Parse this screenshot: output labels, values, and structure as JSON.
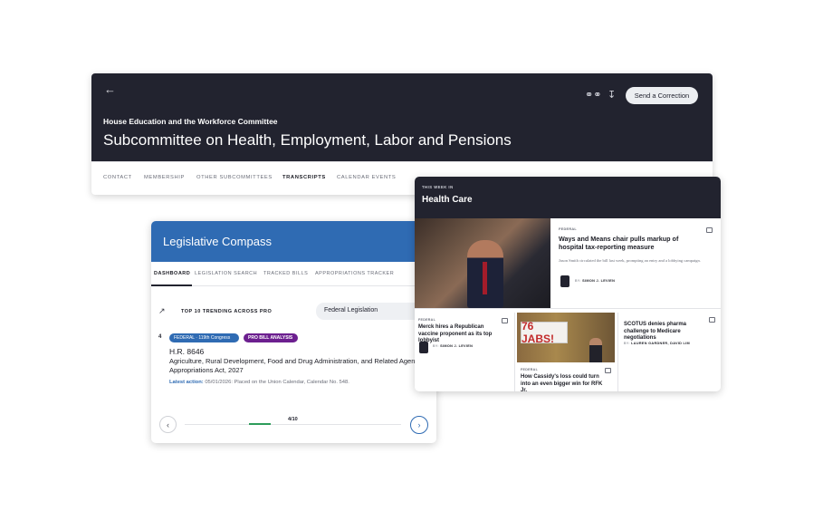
{
  "committee": {
    "back_icon": "arrow-left-icon",
    "kicker": "House Education and the Workforce Committee",
    "title": "Subcommittee on Health, Employment, Labor and Pensions",
    "icons": [
      "binoculars-icon",
      "download-icon"
    ],
    "correction_button": "Send a Correction",
    "tabs": [
      {
        "label": "CONTACT",
        "active": false
      },
      {
        "label": "MEMBERSHIP",
        "active": false
      },
      {
        "label": "OTHER SUBCOMMITTEES",
        "active": false
      },
      {
        "label": "TRANSCRIPTS",
        "active": true
      },
      {
        "label": "CALENDAR EVENTS",
        "active": false
      }
    ],
    "colors": {
      "header_bg": "#22232f"
    }
  },
  "compass": {
    "title": "Legislative Compass",
    "tabs": [
      {
        "label": "DASHBOARD",
        "active": true
      },
      {
        "label": "LEGISLATION SEARCH",
        "active": false
      },
      {
        "label": "TRACKED BILLS",
        "active": false
      },
      {
        "label": "APPROPRIATIONS TRACKER",
        "active": false
      }
    ],
    "trending_label": "TOP 10 TRENDING ACROSS PRO",
    "dropdown_value": "Federal Legislation",
    "item": {
      "rank": "4",
      "badge_federal": "FEDERAL · 119th Congress",
      "badge_pro": "PRO BILL ANALYSIS",
      "bill_number": "H.R. 8646",
      "description": "Agriculture, Rural Development, Food and Drug Administration, and Related Agency Appropriations Act, 2027",
      "action_label": "Latest action:",
      "action_text": "05/01/2026: Placed on the Union Calendar, Calendar No. 548."
    },
    "pager": {
      "prev_icon": "chevron-left-icon",
      "next_icon": "chevron-right-icon",
      "page": "4/10",
      "current": 4,
      "total": 10
    },
    "colors": {
      "header_bg": "#2f6bb3",
      "pro_badge": "#6c1f8f",
      "progress": "#2d9c5a"
    }
  },
  "health": {
    "kicker": "THIS WEEK IN",
    "title": "Health Care",
    "main_story": {
      "tag": "FEDERAL",
      "headline": "Ways and Means chair pulls markup of hospital tax-reporting measure",
      "summary": "Jason Smith circulated the bill last week, prompting an entry and a lobbying campaign.",
      "by": "BY:",
      "author": "SIMON J. LEVIEN"
    },
    "stories": [
      {
        "tag": "FEDERAL",
        "headline": "Merck hires a Republican vaccine proponent as its top lobbyist",
        "by": "BY:",
        "author": "SIMON J. LEVIEN"
      },
      {
        "tag": "FEDERAL",
        "headline": "How Cassidy's loss could turn into an even bigger win for RFK Jr.",
        "image_text": "76 JABS!"
      },
      {
        "tag": "",
        "headline": "SCOTUS denies pharma challenge to Medicare negotiations",
        "by": "BY:",
        "author": "LAUREN GARDNER, DAVID LIM"
      }
    ]
  }
}
